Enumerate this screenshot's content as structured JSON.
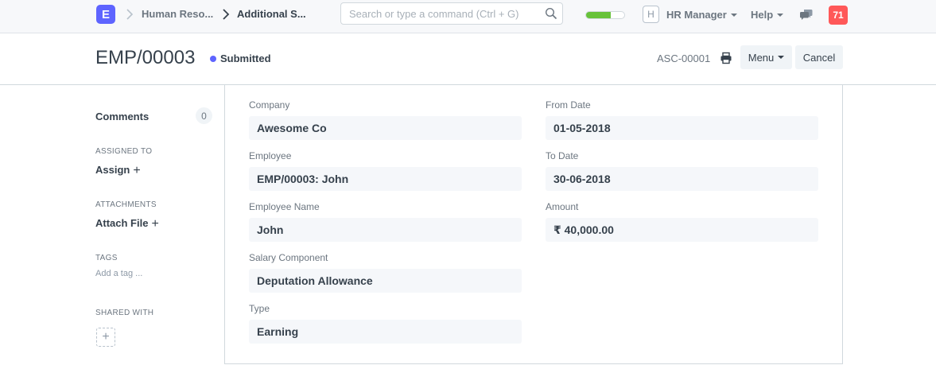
{
  "navbar": {
    "logo_letter": "E",
    "breadcrumbs": [
      "Human Reso...",
      "Additional S..."
    ],
    "search_placeholder": "Search or type a command (Ctrl + G)",
    "setup_progress": 0.65,
    "avatar_initial": "H",
    "user_menu": "HR Manager",
    "help_menu": "Help",
    "notification_count": "71",
    "colors": {
      "brand": "#5e64ff",
      "progress": "#67c23a",
      "notification": "#ff5858"
    },
    "icons": [
      "chevron-right-icon",
      "search-icon",
      "caret-down-icon",
      "chat-icon"
    ]
  },
  "page_head": {
    "title": "EMP/00003",
    "status": "Submitted",
    "status_color": "#5e64ff",
    "doc_id": "ASC-00001",
    "menu_button": "Menu",
    "cancel_button": "Cancel",
    "icons": [
      "print-icon"
    ]
  },
  "sidebar": {
    "comments_label": "Comments",
    "comments_count": "0",
    "assigned_to_label": "ASSIGNED TO",
    "assign_action": "Assign",
    "attachments_label": "ATTACHMENTS",
    "attach_action": "Attach File",
    "tags_label": "TAGS",
    "add_tag": "Add a tag ...",
    "shared_with_label": "SHARED WITH",
    "share_add": "+"
  },
  "form": {
    "left": [
      {
        "label": "Company",
        "value": "Awesome Co"
      },
      {
        "label": "Employee",
        "value": "EMP/00003: John"
      },
      {
        "label": "Employee Name",
        "value": "John"
      },
      {
        "label": "Salary Component",
        "value": "Deputation Allowance"
      },
      {
        "label": "Type",
        "value": "Earning"
      }
    ],
    "right": [
      {
        "label": "From Date",
        "value": "01-05-2018"
      },
      {
        "label": "To Date",
        "value": "30-06-2018"
      },
      {
        "label": "Amount",
        "value": "₹ 40,000.00"
      }
    ]
  }
}
